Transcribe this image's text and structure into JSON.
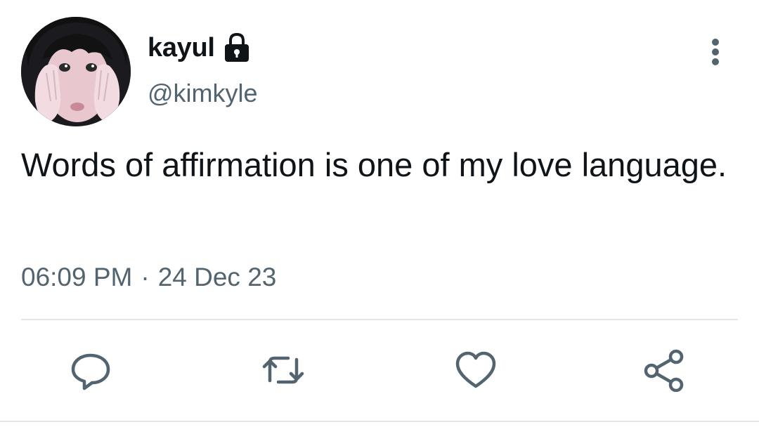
{
  "user": {
    "display_name": "kayul",
    "handle": "@kimkyle",
    "locked": true,
    "avatar_icon": "profile-photo",
    "lock_icon": "lock-icon"
  },
  "tweet": {
    "text": "Words of affirmation is one of my love language.",
    "time": "06:09 PM",
    "separator": "·",
    "date": "24 Dec 23"
  },
  "actions": [
    {
      "name": "reply",
      "icon": "reply-icon"
    },
    {
      "name": "retweet",
      "icon": "retweet-icon"
    },
    {
      "name": "like",
      "icon": "heart-icon"
    },
    {
      "name": "share",
      "icon": "share-icon"
    }
  ],
  "more_menu_icon": "more-vertical-icon",
  "colors": {
    "text": "#0f1419",
    "secondary": "#536471",
    "icon": "#536471",
    "divider": "#e1e8ed"
  }
}
